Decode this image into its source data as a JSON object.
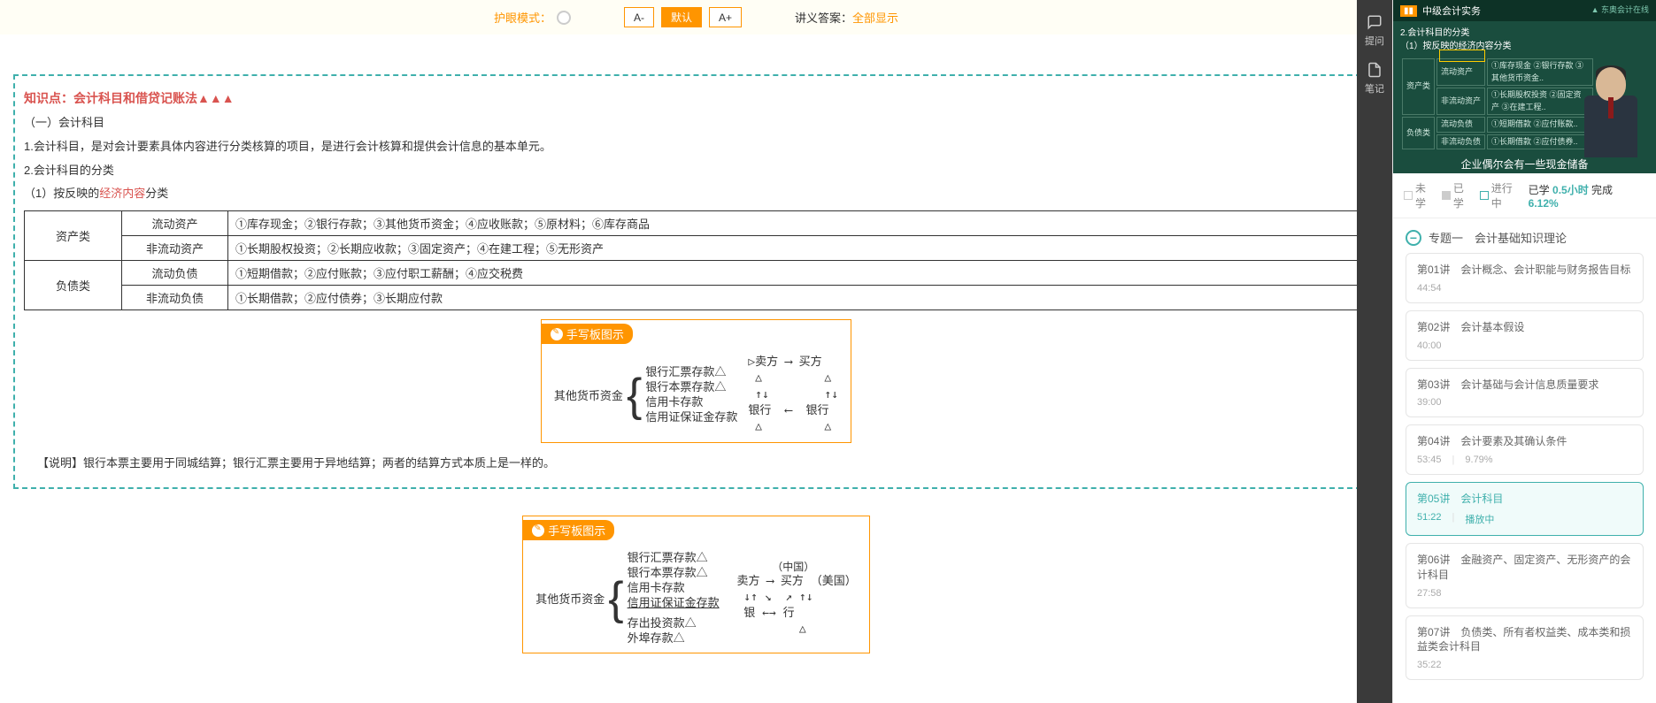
{
  "toolbar": {
    "eye_mode_label": "护眼模式：",
    "font_minus": "A-",
    "font_default": "默认",
    "font_plus": "A+",
    "answer_prefix": "讲义答案：",
    "answer_mode": "全部显示"
  },
  "vert_menu": {
    "ask": "提问",
    "note": "笔记"
  },
  "lecture": {
    "knowledge_title": "知识点：会计科目和借贷记账法▲▲▲",
    "sec1_title": "（一）会计科目",
    "line1": "1.会计科目，是对会计要素具体内容进行分类核算的项目，是进行会计核算和提供会计信息的基本单元。",
    "line2": "2.会计科目的分类",
    "line3_prefix": "（1）按反映的",
    "line3_red": "经济内容",
    "line3_suffix": "分类",
    "table": {
      "r1c1": "资产类",
      "r1c2": "流动资产",
      "r1c3": "①库存现金；②银行存款；③其他货币资金；④应收账款；⑤原材料；⑥库存商品",
      "r2c2": "非流动资产",
      "r2c3": "①长期股权投资；②长期应收款；③固定资产；④在建工程；⑤无形资产",
      "r3c1": "负债类",
      "r3c2": "流动负债",
      "r3c3": "①短期借款；②应付账款；③应付职工薪酬；④应交税费",
      "r4c2": "非流动负债",
      "r4c3": "①长期借款；②应付债券；③长期应付款"
    },
    "handwrite_label": "手写板图示",
    "hw1_left": "其他货币资金",
    "hw1_items": {
      "a": "银行汇票存款△",
      "b": "银行本票存款△",
      "c": "信用卡存款",
      "d": "信用证保证金存款"
    },
    "hw1_diagram": "▷卖方 ⟶ 买方\n △         △\n ↑↓        ↑↓\n银行  ⟵  银行\n △         △",
    "note_text": "【说明】银行本票主要用于同城结算；银行汇票主要用于异地结算；两者的结算方式本质上是一样的。",
    "hw2_left": "其他货币资金",
    "hw2_items": {
      "a": "银行汇票存款△",
      "b": "银行本票存款△",
      "c": "信用卡存款",
      "d": "信用证保证金存款",
      "e": "存出投资款△",
      "f": "外埠存款△"
    },
    "hw2_top": "（中国）",
    "hw2_diagram": " 卖方 ⟶ 买方 （美国）\n  ↓↑ ↘  ↗ ↑↓\n  银 ←→ 行\n          △"
  },
  "video": {
    "course_title": "中级会计实务",
    "slide_line1": "2.会计科目的分类",
    "slide_line2": "（1）按反映的经济内容分类",
    "subtitle": "企业偶尔会有一些现金储备"
  },
  "progress": {
    "not_learned": "未学",
    "learned": "已学",
    "in_progress": "进行中",
    "summary_prefix": "已学 ",
    "hours": "0.5小时",
    "complete_label": " 完成 ",
    "percent": "6.12%"
  },
  "section": {
    "name": "专题一　会计基础知识理论"
  },
  "lessons": [
    {
      "title": "第01讲　会计概念、会计职能与财务报告目标",
      "duration": "44:54",
      "progress": ""
    },
    {
      "title": "第02讲　会计基本假设",
      "duration": "40:00",
      "progress": ""
    },
    {
      "title": "第03讲　会计基础与会计信息质量要求",
      "duration": "39:00",
      "progress": ""
    },
    {
      "title": "第04讲　会计要素及其确认条件",
      "duration": "53:45",
      "progress": "9.79%"
    },
    {
      "title": "第05讲　会计科目",
      "duration": "51:22",
      "progress": "播放中"
    },
    {
      "title": "第06讲　金融资产、固定资产、无形资产的会计科目",
      "duration": "27:58",
      "progress": ""
    },
    {
      "title": "第07讲　负债类、所有者权益类、成本类和损益类会计科目",
      "duration": "35:22",
      "progress": ""
    }
  ]
}
